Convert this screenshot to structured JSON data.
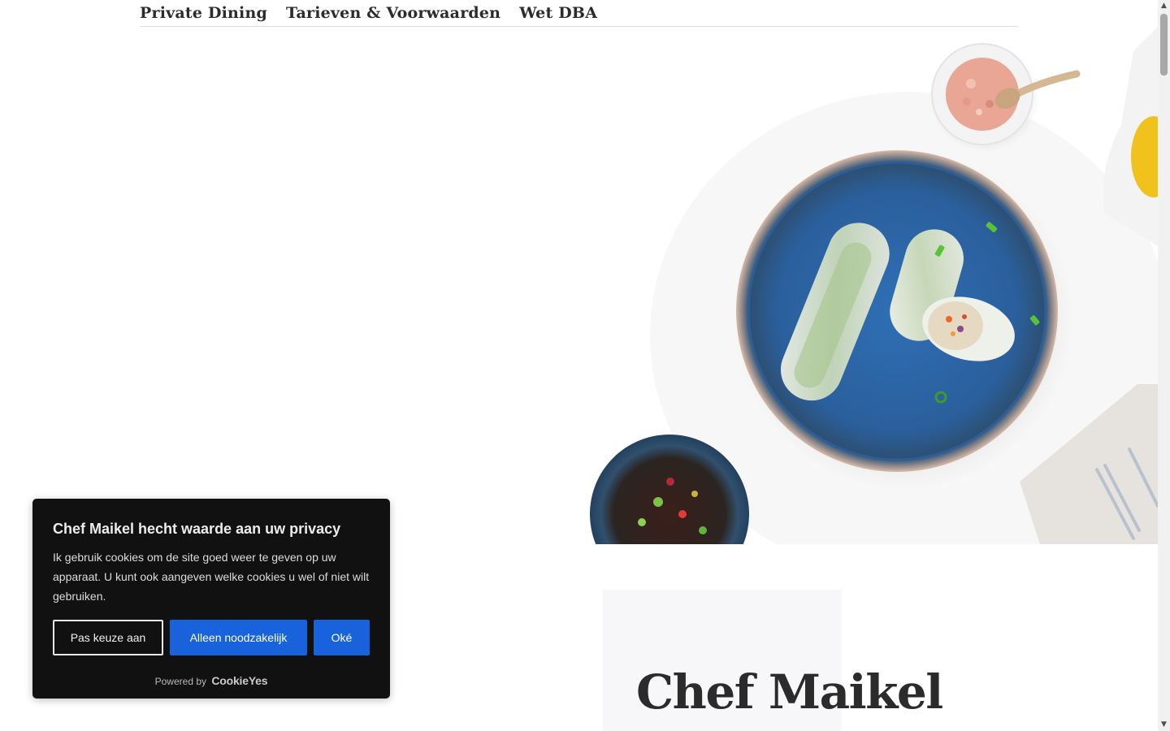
{
  "nav": {
    "items": [
      "Private Dining",
      "Tarieven & Voorwaarden",
      "Wet DBA"
    ]
  },
  "hero": {
    "icon": "food-photo-spring-rolls"
  },
  "chef": {
    "title": "Chef Maikel"
  },
  "cookie_banner": {
    "title": "Chef Maikel hecht waarde aan uw privacy",
    "text": "Ik gebruik cookies om de site goed weer te geven op uw apparaat. U kunt ook aangeven welke cookies u wel of niet wilt gebruiken.",
    "buttons": {
      "customize": "Pas keuze aan",
      "necessary": "Alleen noodzakelijk",
      "accept": "Oké"
    },
    "powered_by": "Powered by",
    "brand": "CookieYes"
  },
  "colors": {
    "accent": "#1863dc",
    "banner_bg": "#111111",
    "heading": "#2b2b2b",
    "plate": "#2f6aa8"
  }
}
